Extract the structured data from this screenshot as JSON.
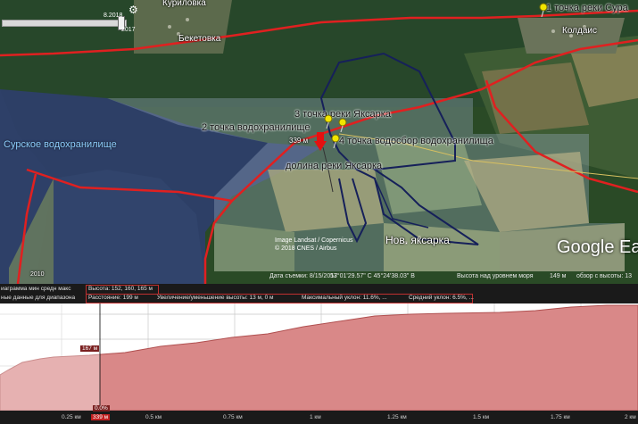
{
  "map": {
    "places": {
      "kurilovka": "Куриловка",
      "beketovka": "Бекетовка",
      "koldais": "Колдаис",
      "reservoir": "Сурское водохранилище",
      "nov_yaksarka": "Нов. яксарка"
    },
    "labels": {
      "point1_sura": "1 точка реки Сура",
      "point2": "2 точка водохранилище",
      "point3": "3 точка реки Яксарка",
      "point4": "4 точка водосбор водохранилища",
      "valley": "долина реки Яксарка",
      "pin_elev": "339 м"
    },
    "time_slider": {
      "date_top": "8.2018",
      "date_bottom": "2017"
    },
    "year_badge": "2010",
    "copyright": [
      "Image Landsat / Copernicus",
      "© 2018 CNES / Airbus"
    ],
    "logo": "Google Ea",
    "status": {
      "date": "Дата съемки: 8/15/2017",
      "coords": "53°01'29.57\" С  45°24'38.03\" В",
      "alt_label": "Высота над уровнем моря",
      "alt_value": "149 м",
      "eye": "обзор с высоты: 13"
    }
  },
  "elevation_bar": {
    "graph_label": "иаграмма мин  средн  макс",
    "height_label": "Высота: 152, 160, 165 м",
    "range_label": "ные данные для диапазона",
    "distance": "Расстояние: 199 м",
    "gain": "Увеличение/уменьшение высоты: 13 м, 0 м",
    "max_slope": "Максимальный уклон: 11.6%, ...",
    "avg_slope": "Средний уклон: 6.5%, ..."
  },
  "profile": {
    "cursor_elev": "167 м",
    "cursor_pct": "0.0%",
    "cursor_dist": "339 м",
    "ticks": [
      "0.25 км",
      "0.5 км",
      "0.75 км",
      "1 км",
      "1.25 км",
      "1.5 км",
      "1.75 км",
      "2 км"
    ]
  },
  "colors": {
    "road": "#e02020",
    "track": "#16205a",
    "profile_fill": "#d98888",
    "pin": "#f2e600"
  }
}
